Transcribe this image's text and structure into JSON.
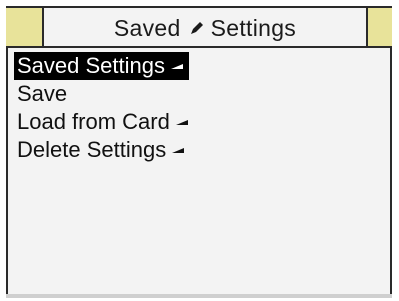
{
  "header": {
    "title_left": "Saved",
    "title_icon": "pencil-icon",
    "title_right": "Settings"
  },
  "menu": {
    "items": [
      {
        "label": "Saved Settings",
        "submenu_icon": "submenu-arrow-icon",
        "selected": true
      },
      {
        "label": "Save",
        "selected": false
      },
      {
        "label": "Load from Card",
        "submenu_icon": "submenu-arrow-icon",
        "selected": false
      },
      {
        "label": "Delete Settings",
        "submenu_icon": "submenu-arrow-icon",
        "selected": false
      }
    ]
  },
  "colors": {
    "tab_strip": "#e8e39a",
    "panel": "#f3f3f3",
    "selection": "#000000"
  }
}
